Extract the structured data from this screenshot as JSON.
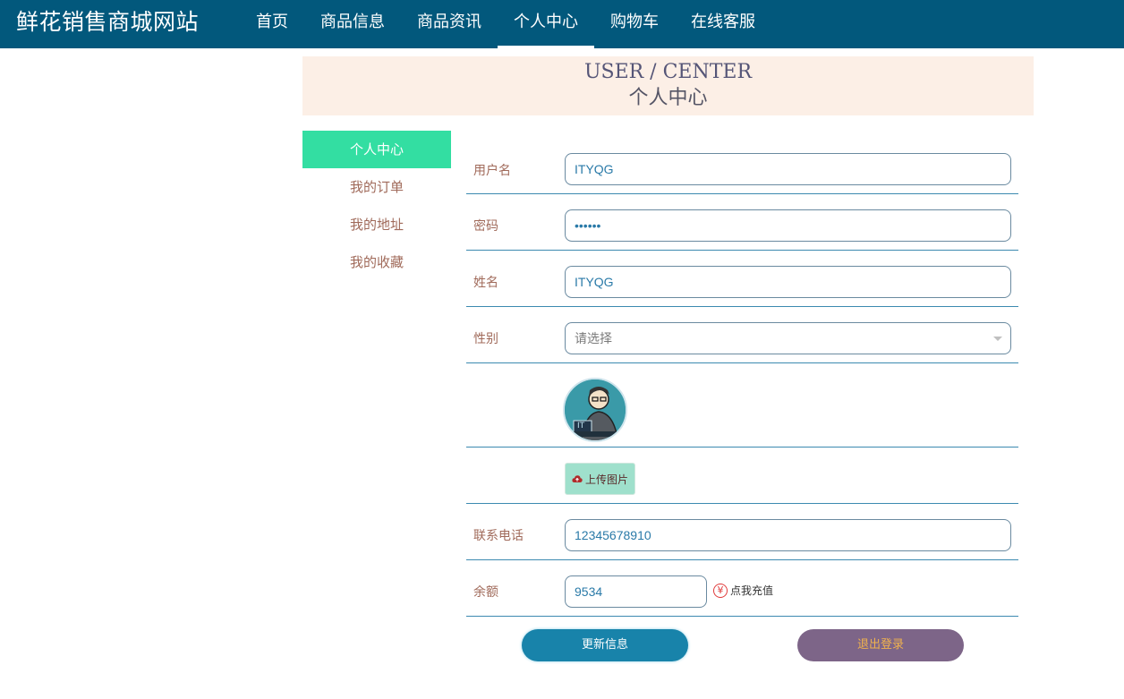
{
  "header": {
    "brand": "鲜花销售商城网站",
    "nav": [
      "首页",
      "商品信息",
      "商品资讯",
      "个人中心",
      "购物车",
      "在线客服"
    ],
    "active_nav": "个人中心"
  },
  "banner": {
    "title_en": "USER / CENTER",
    "title_cn": "个人中心"
  },
  "sidebar": {
    "items": [
      "个人中心",
      "我的订单",
      "我的地址",
      "我的收藏"
    ],
    "active": "个人中心"
  },
  "form": {
    "username_label": "用户名",
    "username_value": "ITYQG",
    "password_label": "密码",
    "password_value": "••••••",
    "name_label": "姓名",
    "name_value": "ITYQG",
    "gender_label": "性别",
    "gender_placeholder": "请选择",
    "upload_label": "上传图片",
    "phone_label": "联系电话",
    "phone_value": "12345678910",
    "balance_label": "余额",
    "balance_value": "9534",
    "recharge_label": "点我充值",
    "recharge_symbol": "¥"
  },
  "buttons": {
    "update": "更新信息",
    "logout": "退出登录"
  },
  "colors": {
    "topbar": "#02587c",
    "sidebar_active": "#33dea2",
    "banner_bg": "#fcefe6",
    "update_button": "#1883aa",
    "logout_button": "#7d6588"
  }
}
